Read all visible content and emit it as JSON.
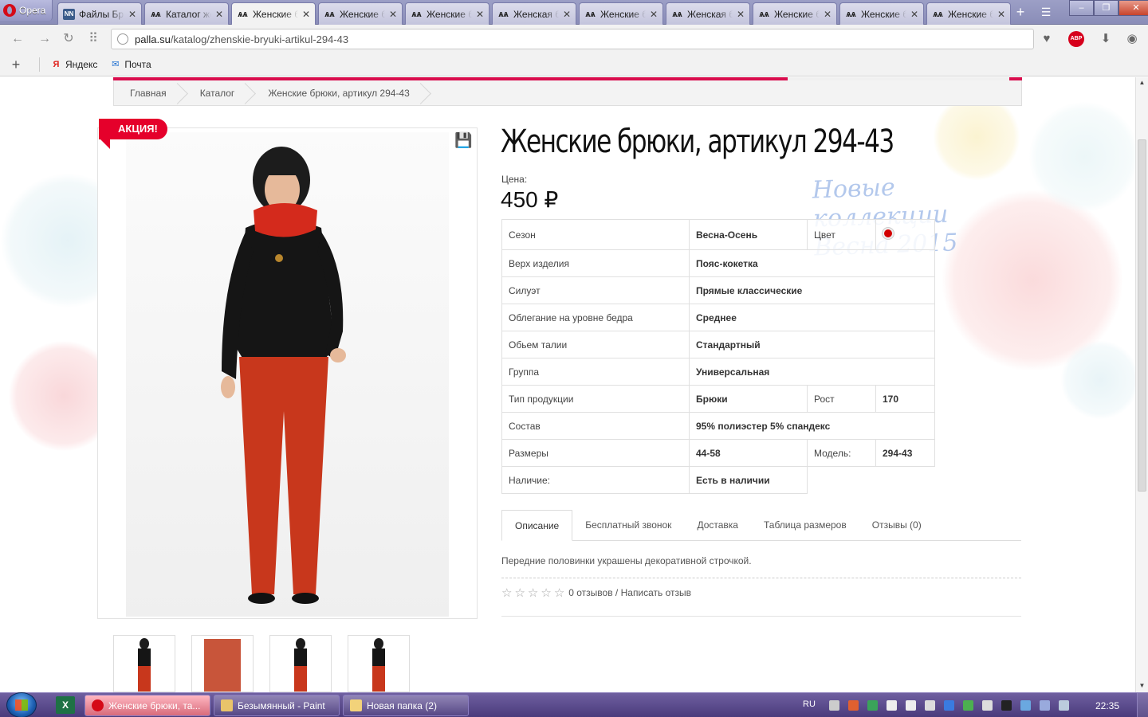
{
  "browser": {
    "menu_label": "Opera",
    "tabs": [
      {
        "title": "Файлы Брюки",
        "icon": "NN"
      },
      {
        "title": "Каталог женской",
        "icon": "palla"
      },
      {
        "title": "Женские брюки",
        "icon": "palla",
        "active": true
      },
      {
        "title": "Женские брюки",
        "icon": "palla"
      },
      {
        "title": "Женские брюки",
        "icon": "palla"
      },
      {
        "title": "Женская блузка",
        "icon": "palla"
      },
      {
        "title": "Женские брюки",
        "icon": "palla"
      },
      {
        "title": "Женская блузка",
        "icon": "palla"
      },
      {
        "title": "Женские брюки",
        "icon": "palla"
      },
      {
        "title": "Женские брюки",
        "icon": "palla"
      },
      {
        "title": "Женские брюки",
        "icon": "palla"
      }
    ],
    "url_host": "palla.su",
    "url_path": "/katalog/zhenskie-bryuki-artikul-294-43",
    "bookmarks": [
      {
        "label": "Яндекс",
        "icon": "Я"
      },
      {
        "label": "Почта",
        "icon": "mail"
      }
    ]
  },
  "breadcrumb": [
    "Главная",
    "Каталог",
    "Женские брюки, артикул 294-43"
  ],
  "product": {
    "promo_badge": "АКЦИЯ!",
    "title": "Женские брюки, артикул 294-43",
    "price_label": "Цена:",
    "price": "450 ₽",
    "collection_text": "Новые коллекции Весна 2015",
    "color_value": "#d30000",
    "specs": {
      "season_label": "Сезон",
      "season_value": "Весна-Осень",
      "color_label": "Цвет",
      "top_label": "Верх изделия",
      "top_value": "Пояс-кокетка",
      "silhouette_label": "Силуэт",
      "silhouette_value": "Прямые классические",
      "hip_label": "Облегание на уровне бедра",
      "hip_value": "Среднее",
      "waist_label": "Обьем талии",
      "waist_value": "Стандартный",
      "group_label": "Группа",
      "group_value": "Универсальная",
      "type_label": "Тип продукции",
      "type_value": "Брюки",
      "height_label": "Рост",
      "height_value": "170",
      "composition_label": "Состав",
      "composition_value": "95% полиэстер 5% спандекс",
      "sizes_label": "Размеры",
      "sizes_value": "44-58",
      "model_label": "Модель:",
      "model_value": "294-43",
      "availability_label": "Наличие:",
      "availability_value": "Есть в наличии"
    },
    "tabs": [
      "Описание",
      "Бесплатный звонок",
      "Доставка",
      "Таблица размеров",
      "Отзывы (0)"
    ],
    "description": "Передние половинки украшены декоративной строчкой.",
    "rating_text": "0 отзывов / Написать отзыв"
  },
  "taskbar": {
    "tasks": [
      "Женские брюки, та...",
      "Безымянный - Paint",
      "Новая папка (2)"
    ],
    "lang": "RU",
    "time": "22:35"
  }
}
